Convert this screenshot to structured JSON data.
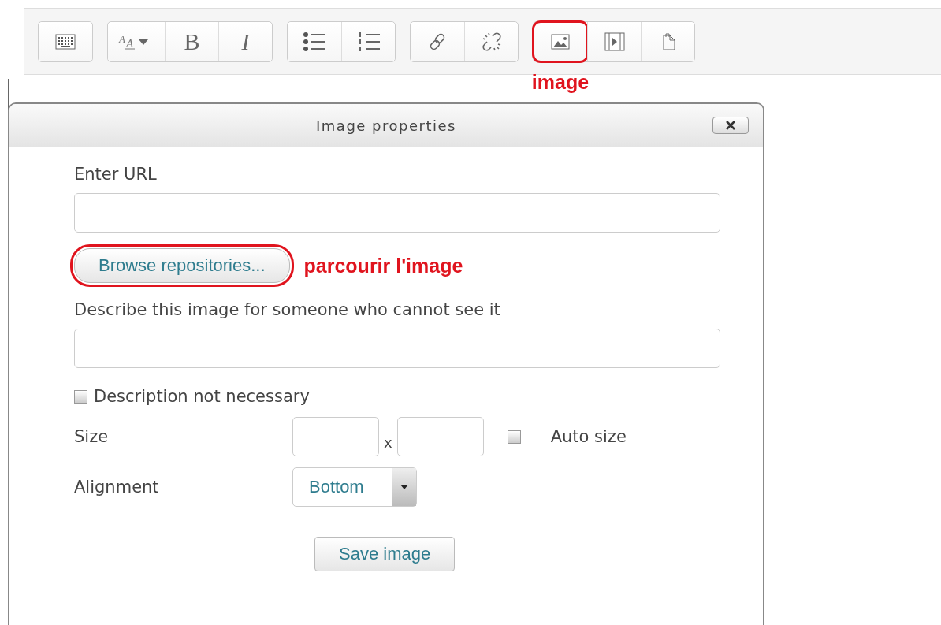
{
  "toolbar": {
    "groups": [
      [
        {
          "kind": "keyboard",
          "highlighted": false
        }
      ],
      [
        {
          "kind": "fontsize",
          "label": "A",
          "sublabel": "A",
          "highlighted": false
        },
        {
          "kind": "text",
          "label": "B",
          "italic": false,
          "highlighted": false
        },
        {
          "kind": "text",
          "label": "I",
          "italic": true,
          "highlighted": false
        }
      ],
      [
        {
          "kind": "bullets",
          "highlighted": false
        },
        {
          "kind": "numbers",
          "highlighted": false
        }
      ],
      [
        {
          "kind": "link",
          "highlighted": false
        },
        {
          "kind": "unlink",
          "highlighted": false
        }
      ],
      [
        {
          "kind": "image",
          "highlighted": true,
          "callout": "image"
        },
        {
          "kind": "video",
          "highlighted": false
        },
        {
          "kind": "paste",
          "highlighted": false
        }
      ]
    ]
  },
  "dialog": {
    "title": "Image properties",
    "url_label": "Enter URL",
    "browse_button": {
      "label": "Browse repositories...",
      "highlighted": true,
      "callout": "parcourir l'image"
    },
    "description_label": "Describe this image for someone who cannot see it",
    "description_not_necessary": {
      "label": "Description not necessary",
      "checked": false
    },
    "size_label": "Size",
    "size_separator": "x",
    "auto_size": {
      "label": "Auto size",
      "checked": false
    },
    "alignment_label": "Alignment",
    "alignment_value": "Bottom",
    "save_button": "Save image"
  }
}
